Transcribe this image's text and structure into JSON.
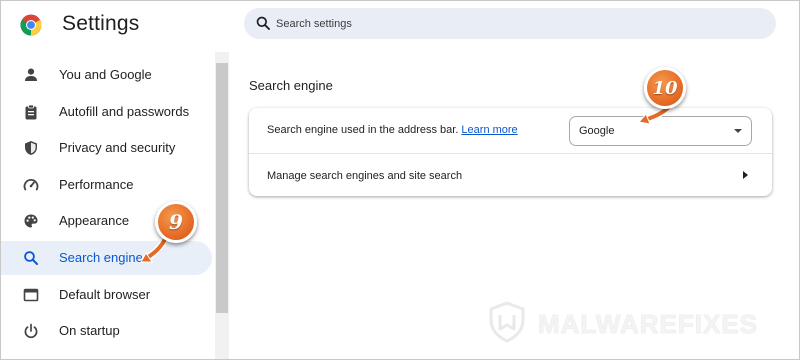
{
  "app": {
    "title": "Settings",
    "logo_icon": "chrome-logo-icon"
  },
  "search": {
    "placeholder": "Search settings",
    "icon": "search-icon"
  },
  "sidebar": {
    "items": [
      {
        "label": "You and Google",
        "icon": "person-icon"
      },
      {
        "label": "Autofill and passwords",
        "icon": "clipboard-icon"
      },
      {
        "label": "Privacy and security",
        "icon": "shield-icon"
      },
      {
        "label": "Performance",
        "icon": "speedometer-icon"
      },
      {
        "label": "Appearance",
        "icon": "palette-icon"
      },
      {
        "label": "Search engine",
        "icon": "search-icon",
        "active": true
      },
      {
        "label": "Default browser",
        "icon": "browser-window-icon"
      },
      {
        "label": "On startup",
        "icon": "power-icon"
      }
    ]
  },
  "main": {
    "section_title": "Search engine",
    "rows": {
      "address_bar_label": "Search engine used in the address bar.",
      "learn_more": "Learn more",
      "selected_engine": "Google",
      "manage_label": "Manage search engines and site search"
    }
  },
  "annotations": {
    "step_a": "9",
    "step_b": "10",
    "badge_color": "#e8702a"
  },
  "watermark": {
    "text": "MALWAREFIXES"
  },
  "colors": {
    "accent": "#0b57d0",
    "active_bg": "#e8eff9",
    "search_bg": "#e9eef6"
  }
}
